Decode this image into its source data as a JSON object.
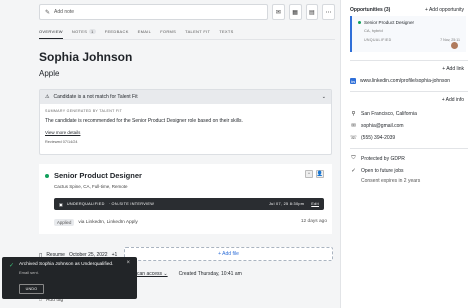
{
  "toolbar": {
    "add_note": "Add note",
    "note_icon": "pencil-icon",
    "buttons": [
      "mail-icon",
      "calendar-icon",
      "briefcase-icon",
      "more-icon"
    ]
  },
  "tabs": [
    {
      "label": "OVERVIEW",
      "active": true
    },
    {
      "label": "NOTES",
      "count": "1"
    },
    {
      "label": "FEEDBACK"
    },
    {
      "label": "EMAIL"
    },
    {
      "label": "FORMS"
    },
    {
      "label": "TALENT FIT"
    },
    {
      "label": "TEXTS"
    }
  ],
  "candidate": {
    "name": "Sophia Johnson",
    "subtitle": "Apple"
  },
  "fit": {
    "header": "Candidate is a not match for Talent Fit",
    "summary_label": "SUMMARY GENERATED BY TALENT FIT",
    "text": "The candidate is recommended for the Senior Product Designer role based on their skills.",
    "link": "View more details",
    "reviewed": "Reviewed 07/14/24"
  },
  "opportunity": {
    "title": "Senior Product Designer",
    "location": "Cactus Spine, CA, Full-time, Remote",
    "stage": "UNDERQUALIFIED",
    "stage_detail": "· ON-SITE INTERVIEW",
    "date": "Jul 07, 25 8:30pm",
    "edit": "Edit",
    "applied_badge": "Applied",
    "applied_via": "via LinkedIn, LinkedIn Apply",
    "ago": "12 days ago"
  },
  "resume": {
    "label": "Resume",
    "date": "October 25, 2022",
    "extra": "+1",
    "add_file": "+ Add file"
  },
  "access": {
    "link": "can access",
    "created": "Created Thursday, 10:41 am"
  },
  "add_tag": "Add tag",
  "toast": {
    "message": "Archived Sophia Johnson as Underqualified.",
    "sub": "Email sent.",
    "undo": "UNDO"
  },
  "sidebar": {
    "opps_title": "Opportunities (3)",
    "add_opp": "Add opportunity",
    "card": {
      "title": "Senior Product Designer",
      "loc": "CA, hybrid",
      "stage": "UNQUALIFIED",
      "date": "7 Nov, 25:11"
    },
    "add_link": "Add link",
    "linkedin": "www.linkedin.com/profile/sophia-johnson",
    "add_info": "Add info",
    "location": "San Francisco, California",
    "email": "sophia@gmail.com",
    "phone": "(555) 394-2039",
    "gdpr": "Protected by GDPR",
    "future": "Open to future jobs",
    "consent": "Consent expires in 2 years"
  },
  "colors": {
    "accent": "#2f6fd8",
    "success": "#12a05c",
    "dark": "#222528"
  }
}
